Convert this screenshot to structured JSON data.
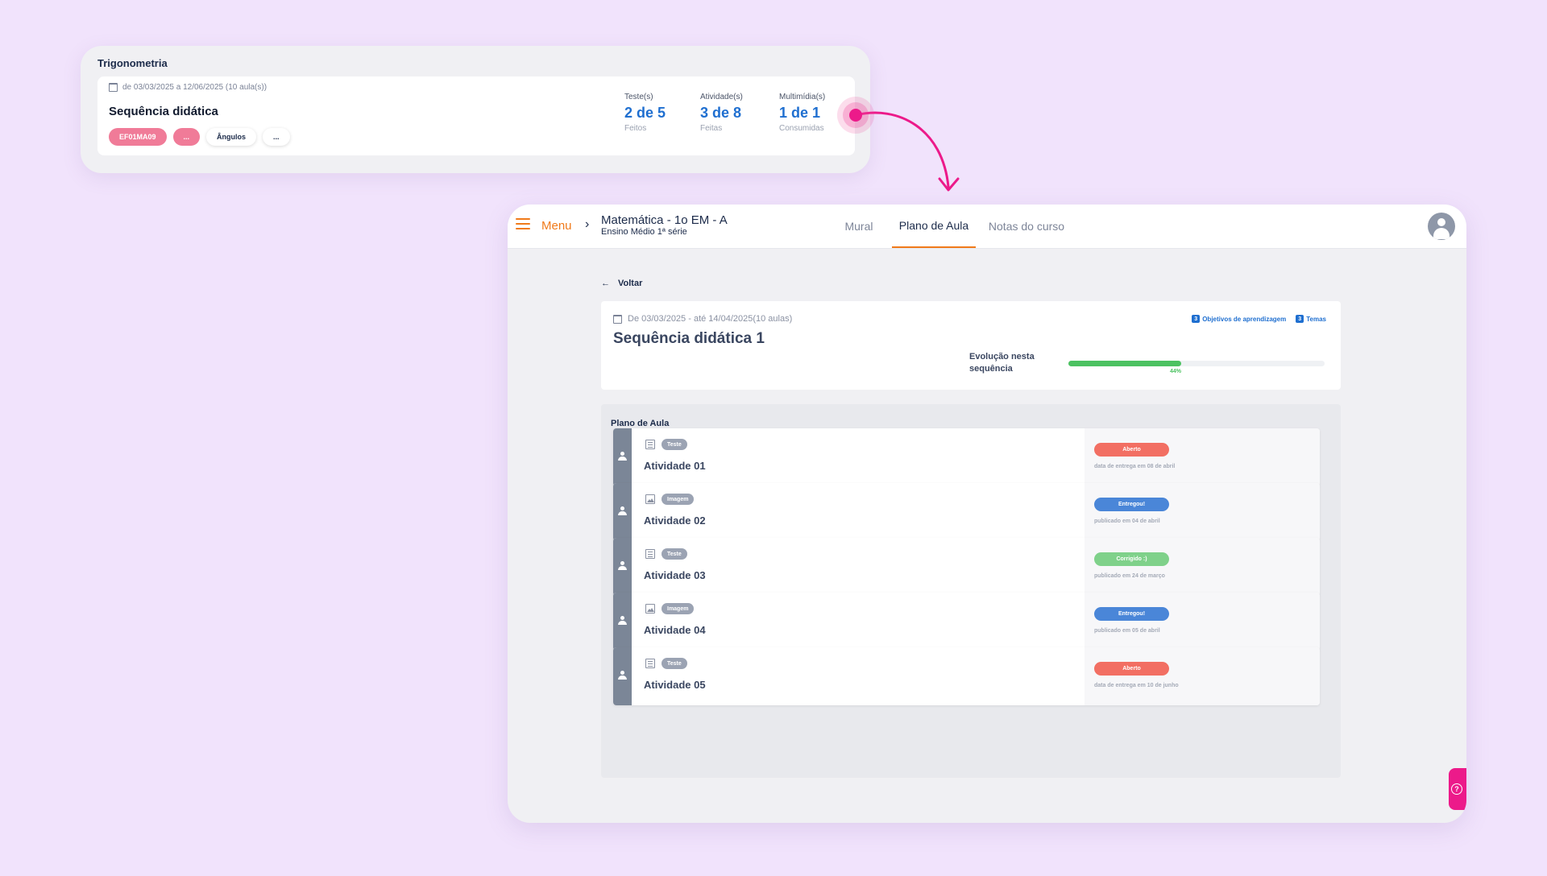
{
  "top_card": {
    "subject": "Trigonometria",
    "date_range": "de 03/03/2025 a 12/06/2025 (10 aula(s))",
    "sequence_title": "Sequência didática",
    "tags": [
      "EF01MA09",
      "...",
      "Ângulos",
      "..."
    ],
    "stats": [
      {
        "label": "Teste(s)",
        "value": "2 de 5",
        "sub": "Feitos"
      },
      {
        "label": "Atividade(s)",
        "value": "3 de 8",
        "sub": "Feitas"
      },
      {
        "label": "Multimídia(s)",
        "value": "1 de 1",
        "sub": "Consumidas"
      }
    ]
  },
  "app": {
    "menu_label": "Menu",
    "breadcrumb": {
      "title": "Matemática - 1o EM - A",
      "subtitle": "Ensino Médio 1ª série"
    },
    "tabs": [
      {
        "label": "Mural",
        "active": false
      },
      {
        "label": "Plano de Aula",
        "active": true
      },
      {
        "label": "Notas do curso",
        "active": false
      }
    ],
    "back_label": "Voltar",
    "sequence": {
      "date_range": "De 03/03/2025 - até 14/04/2025(10 aulas)",
      "title": "Sequência didática 1",
      "badges": [
        {
          "count": "3",
          "label": "Objetivos de aprendizagem"
        },
        {
          "count": "3",
          "label": "Temas"
        }
      ],
      "progress_label": "Evolução nesta sequência",
      "progress_value": 44,
      "progress_text": "44%"
    },
    "plano_title": "Plano de Aula",
    "activities": [
      {
        "name": "Atividade 01",
        "type": "Teste",
        "icon": "list-icon",
        "status": "Aberto",
        "status_color": "#f26f63",
        "note": "data de entrega em 08 de abril"
      },
      {
        "name": "Atividade 02",
        "type": "Imagem",
        "icon": "image-icon",
        "status": "Entregou!",
        "status_color": "#4a86d8",
        "note": "publicado em 04 de abril"
      },
      {
        "name": "Atividade 03",
        "type": "Teste",
        "icon": "list-icon",
        "status": "Corrigido :)",
        "status_color": "#7fd18a",
        "note": "publicado em 24 de março"
      },
      {
        "name": "Atividade 04",
        "type": "Imagem",
        "icon": "image-icon",
        "status": "Entregou!",
        "status_color": "#4a86d8",
        "note": "publicado em 05 de abril"
      },
      {
        "name": "Atividade 05",
        "type": "Teste",
        "icon": "list-icon",
        "status": "Aberto",
        "status_color": "#f26f63",
        "note": "data de entrega em 10 de junho"
      }
    ],
    "help_icon": "question-icon"
  },
  "colors": {
    "background": "#f1e3fc",
    "accent_orange": "#f07a1a",
    "accent_pink": "#ec1a8a",
    "stat_blue": "#1f6fd0",
    "progress_green": "#4cc261"
  }
}
